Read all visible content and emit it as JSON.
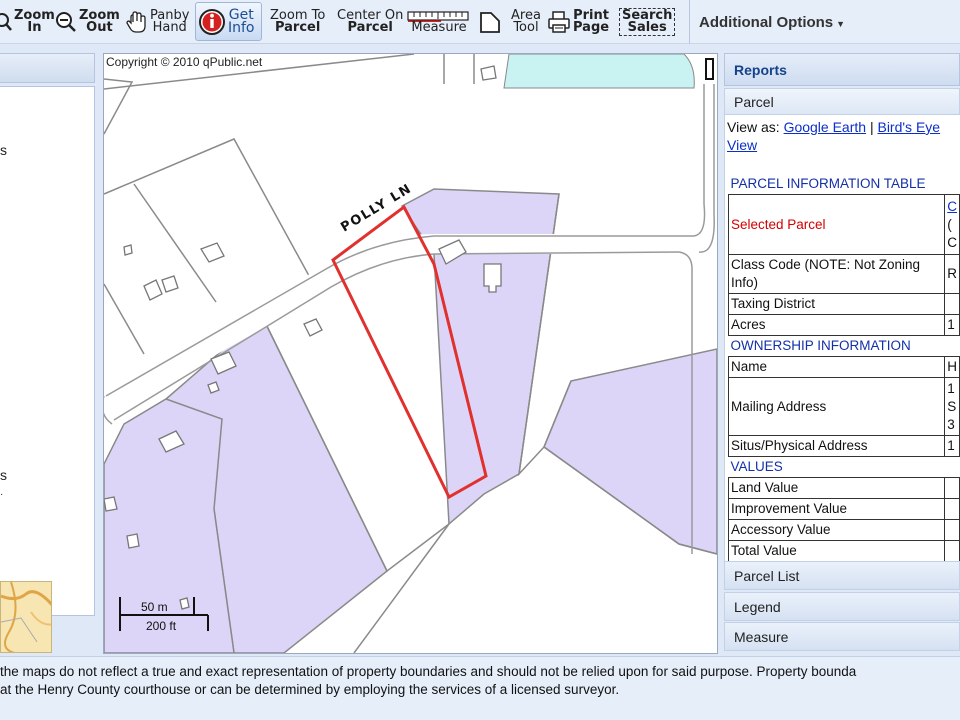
{
  "toolbar": {
    "zoom_in": [
      "Zoom",
      "In"
    ],
    "zoom_out": [
      "Zoom",
      "Out"
    ],
    "pan": [
      "Panby",
      "Hand"
    ],
    "get_info": [
      "Get",
      "Info"
    ],
    "zoom_to_parcel": [
      "Zoom To",
      "Parcel"
    ],
    "center_on_parcel": [
      "Center On",
      "Parcel"
    ],
    "measure": "Measure",
    "area_tool": [
      "Area",
      "Tool"
    ],
    "print_page": [
      "Print",
      "Page"
    ],
    "search_sales": [
      "Search",
      "Sales"
    ],
    "additional_options": "Additional Options",
    "active_tool": "get_info",
    "icons": [
      "magnifier-plus-icon",
      "magnifier-minus-icon",
      "hand-icon",
      "info-icon",
      "ruler-icon",
      "area-shape-icon",
      "printer-icon",
      "caret-down-icon"
    ]
  },
  "left_panel": {
    "fragments": [
      "s",
      "s"
    ]
  },
  "map": {
    "copyright": "Copyright © 2010 qPublic.net",
    "road_label": "POLLY LN",
    "scale": {
      "metric": "50 m",
      "imperial": "200 ft"
    },
    "colors": {
      "parcel_fill": "#dcd5f7",
      "selected_outline": "#e0312f",
      "parcel_line": "#8a8a8a",
      "water": "#c9f2f2"
    }
  },
  "right_panel": {
    "reports_title": "Reports",
    "parcel_tab": "Parcel",
    "view_as_label": "View as:",
    "google_earth": "Google Earth",
    "separator": "|",
    "birds_eye_view": "Bird's Eye View",
    "table_title": "PARCEL INFORMATION TABLE",
    "selected_parcel": "Selected Parcel",
    "class_code": "Class Code (NOTE: Not Zoning Info)",
    "taxing_district": "Taxing District",
    "acres": "Acres",
    "ownership_title": "OWNERSHIP INFORMATION",
    "name": "Name",
    "mailing_address": "Mailing Address",
    "situs_address": "Situs/Physical Address",
    "values_title": "VALUES",
    "land_value": "Land Value",
    "improvement_value": "Improvement Value",
    "accessory_value": "Accessory Value",
    "total_value": "Total Value",
    "partial_values": {
      "selected": "C",
      "selected2": "(",
      "selected3": "C",
      "class": "R",
      "acres": "1",
      "name": "H",
      "mail1": "1",
      "mail2": "S",
      "mail3": "3",
      "situs": "1"
    },
    "accordion": [
      "Parcel List",
      "Legend",
      "Measure"
    ]
  },
  "footer": {
    "line1": "the maps do not reflect a true and exact representation of property boundaries and should not be relied upon for said purpose. Property bounda",
    "line2": "at the Henry County courthouse or can be determined by employing the services of a licensed surveyor."
  }
}
